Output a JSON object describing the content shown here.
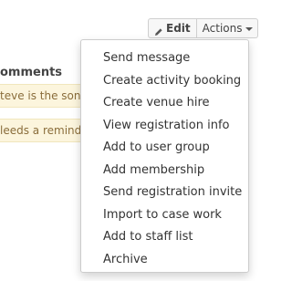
{
  "toolbar": {
    "edit_label": "Edit",
    "actions_label": "Actions"
  },
  "comments": {
    "header": "omments",
    "items": [
      "teve is the son",
      "leeds a remind"
    ]
  },
  "actions_menu": {
    "items": [
      "Send message",
      "Create activity booking",
      "Create venue hire",
      "View registration info",
      "Add to user group",
      "Add membership",
      "Send registration invite",
      "Import to case work",
      "Add to staff list",
      "Archive"
    ]
  },
  "colors": {
    "comment_bg": "#fcf5dd",
    "comment_text": "#8a6d3b"
  },
  "icons": {
    "edit": "pencil-icon",
    "actions": "caret-down-icon"
  }
}
